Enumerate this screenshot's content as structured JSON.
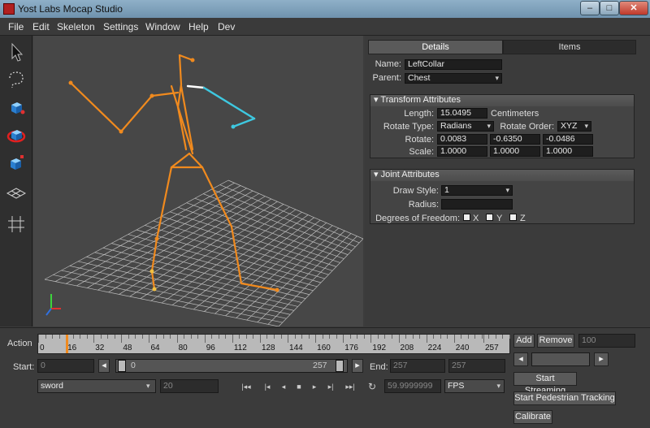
{
  "window": {
    "title": "Yost Labs Mocap Studio",
    "minimize": "–",
    "maximize": "□",
    "close": "✕"
  },
  "menu": [
    "File",
    "Edit",
    "Skeleton",
    "Settings",
    "Window",
    "Help",
    "Dev"
  ],
  "tools": [
    "select-arrow-icon",
    "lasso-icon",
    "move-cube-icon",
    "rotate-cube-icon",
    "scale-cube-icon",
    "grid-plane-icon",
    "snap-grid-icon"
  ],
  "panel": {
    "tabs": [
      "Details",
      "Items"
    ],
    "name_label": "Name:",
    "name_value": "LeftCollar",
    "parent_label": "Parent:",
    "parent_value": "Chest",
    "transform": {
      "header": "Transform Attributes",
      "length_label": "Length:",
      "length_value": "15.0495",
      "length_unit": "Centimeters",
      "rotate_type_label": "Rotate Type:",
      "rotate_type_value": "Radians",
      "rotate_order_label": "Rotate Order:",
      "rotate_order_value": "XYZ",
      "rotate_label": "Rotate:",
      "rotate": [
        "0.0083",
        "-0.6350",
        "-0.0486"
      ],
      "scale_label": "Scale:",
      "scale": [
        "1.0000",
        "1.0000",
        "1.0000"
      ]
    },
    "joint": {
      "header": "Joint Attributes",
      "draw_style_label": "Draw Style:",
      "draw_style_value": "1",
      "radius_label": "Radius:",
      "radius_value": "",
      "dof_label": "Degrees of Freedom:",
      "dof": [
        "X",
        "Y",
        "Z"
      ]
    }
  },
  "timeline": {
    "action_label": "Action",
    "ticks": [
      "0",
      "16",
      "32",
      "48",
      "64",
      "80",
      "96",
      "112",
      "128",
      "144",
      "160",
      "176",
      "192",
      "208",
      "224",
      "240",
      "257"
    ],
    "marker_frame": 16,
    "max_frame": 272,
    "start_label": "Start:",
    "start_value": "0",
    "range_start": "0",
    "range_end": "257",
    "end_label": "End:",
    "end_value": "257",
    "end_value2": "257",
    "action_name": "sword",
    "frame_field": "20",
    "fps_value": "59.9999999",
    "fps_unit": "FPS"
  },
  "right_controls": {
    "add": "Add",
    "remove": "Remove",
    "count": "100",
    "start_streaming": "Start Streaming",
    "start_pedestrian": "Start Pedestrian Tracking",
    "calibrate": "Calibrate"
  },
  "colors": {
    "bone": "#f08a1e",
    "selected_bone": "#3ec8e0",
    "grid": "#bdbdbd"
  }
}
